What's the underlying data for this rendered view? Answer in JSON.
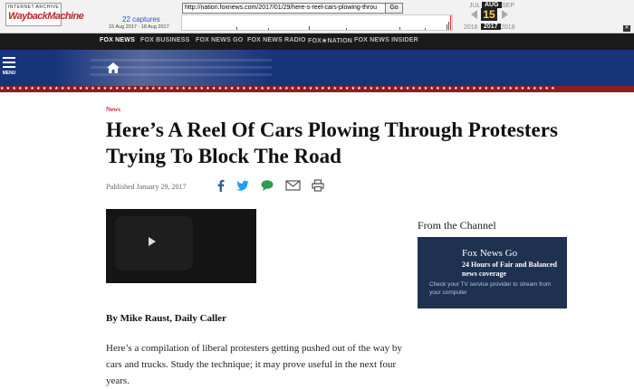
{
  "wayback": {
    "logo_top": "INTERNET ARCHIVE",
    "logo_name": "WaybackMachine",
    "url": "http://nation.foxnews.com/2017/01/29/here-s-reel-cars-plowing-throu",
    "go_label": "Go",
    "captures": "22 captures",
    "date_range": "15 Aug 2017 - 18 Aug 2017",
    "prev_month": "JUL",
    "cur_month": "AUG",
    "next_month": "SEP",
    "day": "15",
    "prev_year": "2016",
    "cur_year": "2017",
    "next_year": "2018",
    "close_label": "✕"
  },
  "network": [
    "FOX NEWS",
    "FOX BUSINESS",
    "FOX NEWS GO",
    "FOX NEWS RADIO",
    "FOX★NATION",
    "FOX NEWS INSIDER"
  ],
  "banner": {
    "menu_label": "MENU",
    "stars": "★★★★★★★★★★★★★★★★★★★★★★★★★★★★★★★★★★★★★★★★★★★★★★★★★★★★★★★★★★★★★★★★★★★★★★★★★★★★★★★★★★★★★★★★★★★★"
  },
  "article": {
    "section": "News",
    "headline": "Here’s A Reel Of Cars Plowing Through Protesters Trying To Block The Road",
    "published": "Published January 29, 2017",
    "byline": "By Mike Raust, Daily Caller",
    "paragraph1": "Here’s a compilation of liberal protesters getting pushed out of the way by cars and trucks. Study the technique; it may prove useful in the next four years."
  },
  "sidebar": {
    "heading": "From the Channel",
    "promo_title": "Fox News Go",
    "promo_sub": "24 Hours of Fair and Balanced news coverage",
    "promo_note": "Check your TV service provider to stream from your computer"
  },
  "colors": {
    "banner": "#17347b",
    "star_strip": "#8c1d20",
    "promo_bg": "#1e3150",
    "section": "#c1272d",
    "facebook": "#3b5998",
    "twitter": "#1da1f2",
    "comment": "#2e9a4f"
  }
}
